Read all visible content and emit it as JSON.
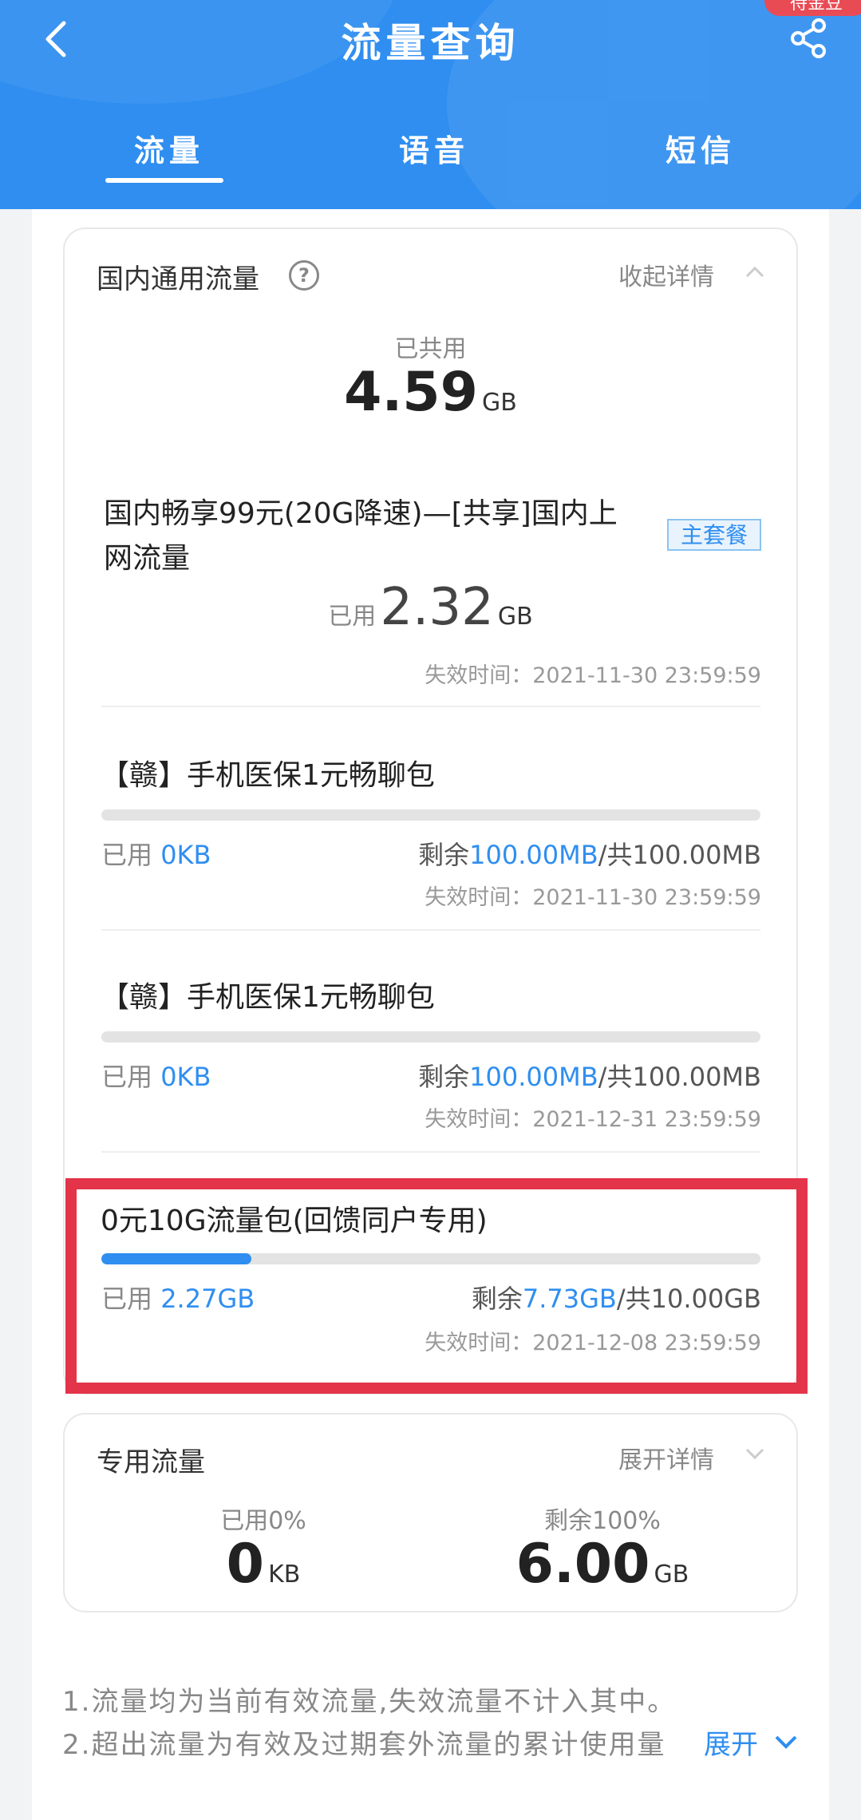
{
  "header": {
    "title": "流量查询",
    "corner_badge": "待金豆",
    "tabs": [
      {
        "label": "流量",
        "active": true
      },
      {
        "label": "语音",
        "active": false
      },
      {
        "label": "短信",
        "active": false
      }
    ]
  },
  "domestic": {
    "title": "国内通用流量",
    "help": "?",
    "collapse_label": "收起详情",
    "total_used_label": "已共用",
    "total_used_value": "4.59",
    "total_used_unit": "GB",
    "main_plan": {
      "name": "国内畅享99元(20G降速)—[共享]国内上网流量",
      "badge": "主套餐",
      "used_label": "已用",
      "used_value": "2.32",
      "used_unit": "GB",
      "expire": "失效时间：2021-11-30 23:59:59"
    },
    "packages": [
      {
        "name": "【赣】手机医保1元畅聊包",
        "used_label": "已用",
        "used_value": "0KB",
        "remain_label": "剩余",
        "remain_value": "100.00MB",
        "total_text": "/共100.00MB",
        "progress": 0,
        "expire": "失效时间：2021-11-30 23:59:59"
      },
      {
        "name": "【赣】手机医保1元畅聊包",
        "used_label": "已用",
        "used_value": "0KB",
        "remain_label": "剩余",
        "remain_value": "100.00MB",
        "total_text": "/共100.00MB",
        "progress": 0,
        "expire": "失效时间：2021-12-31 23:59:59"
      },
      {
        "name": "0元10G流量包(回馈同户专用)",
        "used_label": "已用",
        "used_value": "2.27GB",
        "remain_label": "剩余",
        "remain_value": "7.73GB",
        "total_text": "/共10.00GB",
        "progress": 0.227,
        "expire": "失效时间：2021-12-08 23:59:59"
      }
    ]
  },
  "dedicated": {
    "title": "专用流量",
    "expand_label": "展开详情",
    "used_label": "已用0%",
    "used_value": "0",
    "used_unit": "KB",
    "remain_label": "剩余100%",
    "remain_value": "6.00",
    "remain_unit": "GB"
  },
  "notes": {
    "line1": "1.流量均为当前有效流量,失效流量不计入其中。",
    "line2": "2.超出流量为有效及过期套外流量的累计使用量",
    "expand": "展开"
  },
  "colors": {
    "header_blue": "#2f8ef0",
    "accent_blue": "#2f8ef0",
    "highlight_red": "#e3344a",
    "badge_red": "#e94b55"
  }
}
